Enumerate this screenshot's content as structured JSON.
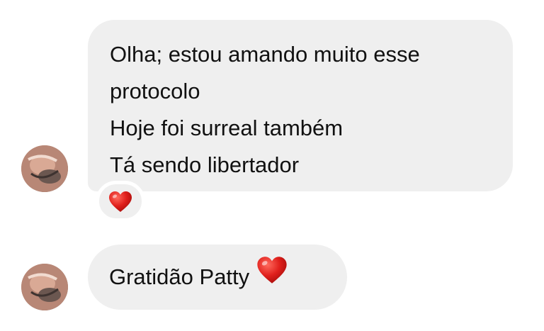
{
  "messages": [
    {
      "lines": [
        "Olha; estou amando muito esse",
        "protocolo",
        "Hoje foi surreal também",
        "Tá sendo libertador"
      ],
      "reaction": "heart-icon"
    },
    {
      "text": "Gratidão Patty",
      "emoji": "heart-icon"
    }
  ],
  "colors": {
    "bubble": "#efefef",
    "text": "#111111",
    "heart": "#e0201c"
  }
}
